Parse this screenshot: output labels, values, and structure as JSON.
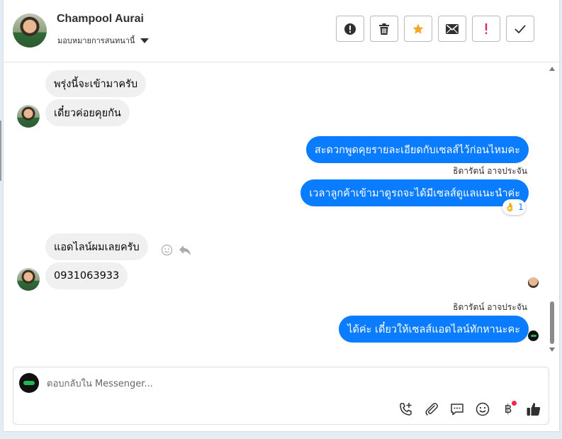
{
  "header": {
    "name": "Champool Aurai",
    "assign_label": "มอบหมายการสนทนานี้",
    "actions": [
      "spam-icon",
      "trash-icon",
      "star-icon",
      "mail-icon",
      "exclamation-icon",
      "check-icon"
    ]
  },
  "messages": [
    {
      "dir": "in",
      "text": "พรุ่งนี้จะเข้ามาครับ"
    },
    {
      "dir": "in",
      "text": "เดี๋ยวค่อยคุยกัน"
    },
    {
      "dir": "out",
      "text": "สะดวกพูดคุยรายละเอียดกับเซลส์ไว้ก่อนไหมคะ"
    },
    {
      "dir": "out",
      "sender": "ธิดารัตน์ อาจประจัน",
      "text": "เวลาลูกค้าเข้ามาดูรถจะได้มีเซลส์ดูแลแนะนำค่ะ",
      "reaction": {
        "emoji": "👌",
        "count": "1"
      }
    },
    {
      "dir": "in",
      "text": "แอดไลน์ผมเลยครับ"
    },
    {
      "dir": "in",
      "text": "0931063933"
    },
    {
      "dir": "out",
      "sender": "ธิดารัตน์ อาจประจัน",
      "text": "ได้ค่ะ เดี๋ยวให้เซลส์แอดไลน์ทักหานะคะ"
    }
  ],
  "composer": {
    "placeholder": "ตอบกลับใน Messenger...",
    "tools": [
      "call-add-icon",
      "attach-icon",
      "saved-reply-icon",
      "emoji-icon",
      "baht-icon",
      "like-icon"
    ],
    "baht_symbol": "฿"
  },
  "colors": {
    "outgoing_bubble": "#0a7cff",
    "incoming_bubble": "#f0f0f0",
    "star": "#f5a623",
    "exclamation": "#e0245e"
  }
}
